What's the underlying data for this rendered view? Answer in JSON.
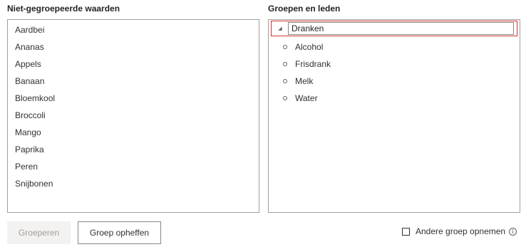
{
  "ungrouped": {
    "heading": "Niet-gegroepeerde waarden",
    "items": [
      "Aardbei",
      "Ananas",
      "Appels",
      "Banaan",
      "Bloemkool",
      "Broccoli",
      "Mango",
      "Paprika",
      "Peren",
      "Snijbonen"
    ]
  },
  "groups": {
    "heading": "Groepen en leden",
    "group": {
      "toggle_icon": "collapse-triangle-icon",
      "toggle_glyph": "◢",
      "name": "Dranken",
      "members": [
        "Alcohol",
        "Frisdrank",
        "Melk",
        "Water"
      ]
    }
  },
  "buttons": {
    "group": "Groeperen",
    "ungroup": "Groep opheffen"
  },
  "include_other": {
    "label": "Andere groep opnemen",
    "checked": false,
    "info_icon": "info-icon",
    "info_glyph": "i"
  },
  "colors": {
    "active_border": "#d13438",
    "panel_border": "#a19f9d",
    "disabled_button_bg": "#f3f2f1"
  }
}
